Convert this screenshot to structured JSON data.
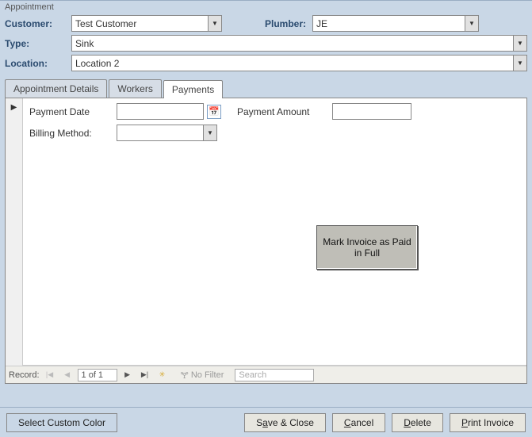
{
  "window": {
    "title": "Appointment"
  },
  "header": {
    "customer": {
      "label": "Customer:",
      "value": "Test Customer"
    },
    "plumber": {
      "label": "Plumber:",
      "value": "JE"
    },
    "type": {
      "label": "Type:",
      "value": "Sink"
    },
    "location": {
      "label": "Location:",
      "value": "Location 2"
    }
  },
  "tabs": {
    "t0": {
      "label": "Appointment Details"
    },
    "t1": {
      "label": "Workers"
    },
    "t2": {
      "label": "Payments",
      "active": true
    }
  },
  "payments": {
    "payment_date": {
      "label": "Payment Date",
      "value": ""
    },
    "payment_amount": {
      "label": "Payment Amount",
      "value": ""
    },
    "billing_method": {
      "label": "Billing Method:",
      "value": ""
    },
    "mark_paid_button": "Mark Invoice as Paid in Full"
  },
  "recordnav": {
    "label": "Record:",
    "position": "1 of 1",
    "no_filter": "No Filter",
    "search_placeholder": "Search"
  },
  "footer": {
    "select_color": "Select Custom Color",
    "save_close": {
      "pre": "S",
      "u": "a",
      "post": "ve & Close"
    },
    "cancel": {
      "pre": "",
      "u": "C",
      "post": "ancel"
    },
    "delete": {
      "pre": "",
      "u": "D",
      "post": "elete"
    },
    "print_invoice": {
      "pre": "",
      "u": "P",
      "post": "rint Invoice"
    }
  }
}
